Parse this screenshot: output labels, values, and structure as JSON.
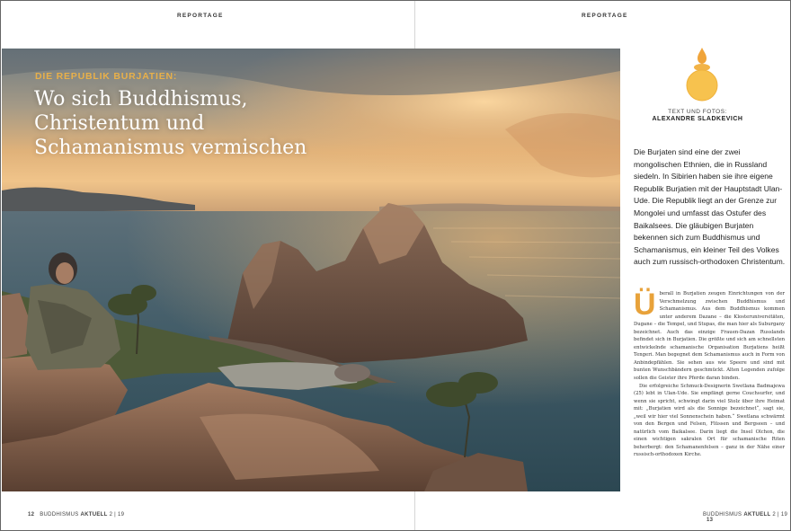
{
  "section_label": "REPORTAGE",
  "kicker": "DIE REPUBLIK BURJATIEN:",
  "headline_lines": [
    "Wo sich Buddhismus,",
    "Christentum und",
    "Schamanismus vermischen"
  ],
  "credit": {
    "label": "TEXT UND FOTOS:",
    "author": "ALEXANDRE SLADKEVICH"
  },
  "intro": "Die Burjaten sind eine der zwei mongolischen Ethnien, die in Russland siedeln. In Sibirien haben sie ihre eigene Republik Burjatien mit der Hauptstadt Ulan-Ude. Die Republik liegt an der Grenze zur Mongolei und umfasst das Ostufer des Baikalsees. Die gläubigen Burjaten bekennen sich zum Buddhismus und Schamanismus, ein kleiner Teil des Volkes auch zum russisch-orthodoxen Christentum.",
  "body": {
    "drop_cap": "Ü",
    "p1": "berall in Burjatien zeugen Einrichtungen von der Verschmelzung zwischen Buddhismus und Schamanismus. Aus dem Buddhismus kommen unter anderem Dazane – die Klosteruniversitäten, Dugane – die Tempel, und Stupas, die man hier als Suburgany bezeichnet. Auch das einzige Frauen-Dazan Russlands befindet sich in Burjatien. Die größte und sich am schnellsten entwickelnde schamanische Organisation Burjatiens heißt Tengeri. Man begegnet dem Schamanismus auch in Form von Anbindepfählen. Sie sehen aus wie Speere und sind mit bunten Wunschbändern geschmückt. Alten Legenden zufolge sollen die Geister ihre Pferde daran binden.",
    "p2": "Die erfolgreiche Schmuck-Designerin Swetlana Badmajewa (25) lebt in Ulan-Ude. Sie empfängt gerne Couchsurfer, und wenn sie spricht, schwingt darin viel Stolz über ihre Heimat mit: „Burjatien wird als die Sonnige bezeichnet“, sagt sie, „weil wir hier viel Sonnenschein haben.“ Swetlana schwärmt von den Bergen und Felsen, Flüssen und Bergseen – und natürlich vom Baikalsee. Darin liegt die Insel Olchon, die einen wichtigen sakralen Ort für schamanische Riten beherbergt: den Schamanenfelsen – ganz in der Nähe einer russisch-orthodoxen Kirche."
  },
  "footer": {
    "left_page": "12",
    "right_page": "13",
    "magazine": "BUDDHISMUS",
    "magazine_bold": "AKTUELL",
    "issue": "2 | 19"
  },
  "colors": {
    "accent": "#e8a23a",
    "kicker": "#e8b04a"
  }
}
